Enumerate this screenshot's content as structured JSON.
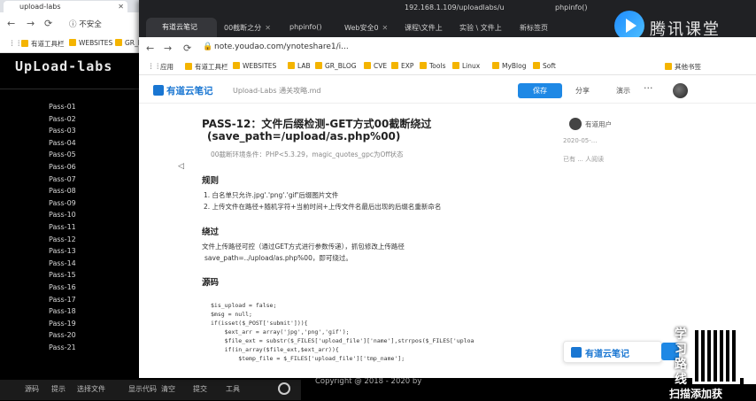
{
  "back_browser": {
    "tab_title": "upload-labs",
    "security_label": "不安全",
    "bookmarks": [
      "有道工具栏",
      "WEBSITES",
      "GR_BL"
    ]
  },
  "site": {
    "logo": "UpLoad-labs",
    "pass_items": [
      "Pass-01",
      "Pass-02",
      "Pass-03",
      "Pass-04",
      "Pass-05",
      "Pass-06",
      "Pass-07",
      "Pass-08",
      "Pass-09",
      "Pass-10",
      "Pass-11",
      "Pass-12",
      "Pass-13",
      "Pass-14",
      "Pass-15",
      "Pass-16",
      "Pass-17",
      "Pass-18",
      "Pass-19",
      "Pass-20",
      "Pass-21"
    ],
    "footer": "Copyright @ 2018 - 2020 by",
    "taskbar_items": [
      "源码",
      "提示",
      "选择文件",
      "显示代码",
      "清空",
      "提交",
      "工具"
    ]
  },
  "front_browser": {
    "tabs": [
      "有道云笔记",
      "00截断之分",
      "phpinfo()",
      "Web安全0",
      "课程\\文件上",
      "192.168.1.109/uploadlabs/u",
      "实验 \\ 文件上",
      "新标签页",
      "phpinfo()"
    ],
    "active_tab": "有道云笔记",
    "url": "note.youdao.com/ynoteshare1/i...",
    "bookmarks": [
      "应用",
      "有道工具栏",
      "WEBSITES",
      "LAB",
      "GR_BLOG",
      "CVE",
      "EXP",
      "Tools",
      "Linux",
      "MyBlog",
      "Soft",
      "其他书签"
    ],
    "brand": "腾讯课堂"
  },
  "note": {
    "logo": "有道云笔记",
    "doc_name": "Upload-Labs 通关攻略.md",
    "save_button": "保存",
    "share_label": "分享",
    "present_label": "演示",
    "more_label": "···",
    "title": "PASS-12：文件后缀检测-GET方式00截断绕过",
    "subtitle": "(save_path=/upload/as.php%00)",
    "meta": "00截断环境条件：PHP<5.3.29，magic_quotes_gpc为Off状态",
    "section_rules": "规则",
    "rules": [
      "1. 白名单只允许.jpg'.'png'.'gif'后缀图片文件",
      "2. 上传文件在路径+随机字符+当前时间+上传文件名最后出现的后缀名重新命名"
    ],
    "section_bypass": "绕过",
    "bypass_line1": "文件上传路径可控（通过GET方式进行参数传递），抓包修改上传路径",
    "bypass_line2": "save_path=../upload/as.php%00，即可绕过。",
    "section_code": "源码",
    "code_lines": [
      "$is_upload = false;",
      "$msg = null;",
      "if(isset($_POST['submit'])){",
      "    $ext_arr = array('jpg','png','gif');",
      "    $file_ext = substr($_FILES['upload_file']['name'],strrpos($_FILES['uploa",
      "    if(in_array($file_ext,$ext_arr)){",
      "        $temp_file = $_FILES['upload_file']['tmp_name'];"
    ],
    "author_name": "有道用户",
    "author_line1": "2020-05-...",
    "author_line2": "已有 ... 人阅读",
    "float_label": "有道云笔记"
  },
  "promo": {
    "text": "学习路线",
    "scan": "扫描添加获"
  }
}
